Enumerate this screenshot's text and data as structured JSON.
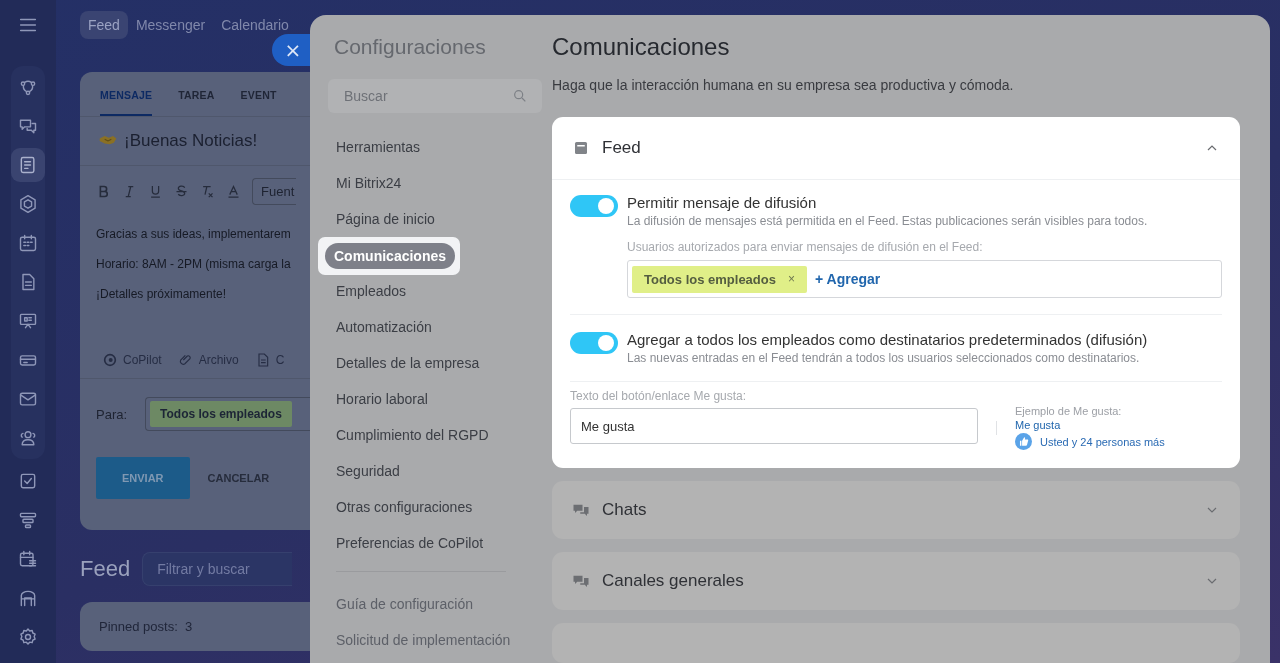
{
  "rail": {
    "items": [
      {
        "selected": false
      },
      {
        "selected": false
      },
      {
        "selected": true
      },
      {
        "selected": false
      },
      {
        "selected": false
      },
      {
        "selected": false
      },
      {
        "selected": false
      },
      {
        "selected": false
      },
      {
        "selected": false
      },
      {
        "selected": false
      },
      {
        "selected": false
      },
      {
        "selected": false
      },
      {
        "selected": false
      },
      {
        "selected": false
      }
    ]
  },
  "top_nav": [
    {
      "label": "Feed",
      "selected": true
    },
    {
      "label": "Messenger",
      "selected": false
    },
    {
      "label": "Calendario",
      "selected": false
    }
  ],
  "composer": {
    "tabs": [
      {
        "label": "MENSAJE",
        "selected": true
      },
      {
        "label": "TAREA",
        "selected": false
      },
      {
        "label": "EVENT",
        "selected": false
      }
    ],
    "title": "¡Buenas Noticias!",
    "font_select": "Fuent",
    "body": [
      "Gracias a sus ideas, implementarem",
      "Horario: 8AM - 2PM (misma carga la",
      "¡Detalles próximamente!"
    ],
    "attachments": [
      "CoPilot",
      "Archivo",
      "C"
    ],
    "to_label": "Para:",
    "recipient": "Todos los empleados",
    "send": "ENVIAR",
    "cancel": "CANCELAR"
  },
  "feed": {
    "heading": "Feed",
    "filter_placeholder": "Filtrar y buscar",
    "pinned_label": "Pinned posts:",
    "pinned_count": "3"
  },
  "close_button": "×",
  "settings": {
    "title": "Configuraciones",
    "search_placeholder": "Buscar",
    "menu": [
      {
        "label": "Herramientas",
        "selected": false
      },
      {
        "label": "Mi Bitrix24",
        "selected": false
      },
      {
        "label": "Página de inicio",
        "selected": false
      },
      {
        "label": "Comunicaciones",
        "selected": true
      },
      {
        "label": "Empleados",
        "selected": false
      },
      {
        "label": "Automatización",
        "selected": false
      },
      {
        "label": "Detalles de la empresa",
        "selected": false
      },
      {
        "label": "Horario laboral",
        "selected": false
      },
      {
        "label": "Cumplimiento del RGPD",
        "selected": false
      },
      {
        "label": "Seguridad",
        "selected": false
      },
      {
        "label": "Otras configuraciones",
        "selected": false
      },
      {
        "label": "Preferencias de CoPilot",
        "selected": false
      }
    ],
    "links": [
      "Guía de configuración",
      "Solicitud de implementación"
    ],
    "page_title": "Comunicaciones",
    "page_subtitle": "Haga que la interacción humana en su empresa sea productiva y cómoda.",
    "sections": [
      {
        "title": "Feed",
        "kind": "feed",
        "expanded": true,
        "options": [
          {
            "kind": "toggle",
            "on": true,
            "label": "Permitir mensaje de difusión",
            "description": "La difusión de mensajes está permitida en el Feed. Estas publicaciones serán visibles para todos.",
            "users_label": "Usuarios autorizados para enviar mensajes de difusión en el Feed:",
            "tags": [
              {
                "label": "Todos los empleados",
                "remove": "×"
              }
            ],
            "add_link": "+ Agregar"
          },
          {
            "kind": "toggle",
            "on": true,
            "label": "Agregar a todos los empleados como destinatarios predeterminados (difusión)",
            "description": "Las nuevas entradas en el Feed tendrán a todos los usuarios seleccionados como destinatarios."
          }
        ],
        "like": {
          "label": "Texto del botón/enlace Me gusta:",
          "value": "Me gusta",
          "example_label": "Ejemplo de Me gusta:",
          "example_link": "Me gusta",
          "example_text": "Usted y 24 personas más"
        }
      },
      {
        "title": "Chats",
        "kind": "chat",
        "expanded": false
      },
      {
        "title": "Canales generales",
        "kind": "chat",
        "expanded": false
      },
      {
        "kind": "blank",
        "expanded": false
      }
    ]
  }
}
